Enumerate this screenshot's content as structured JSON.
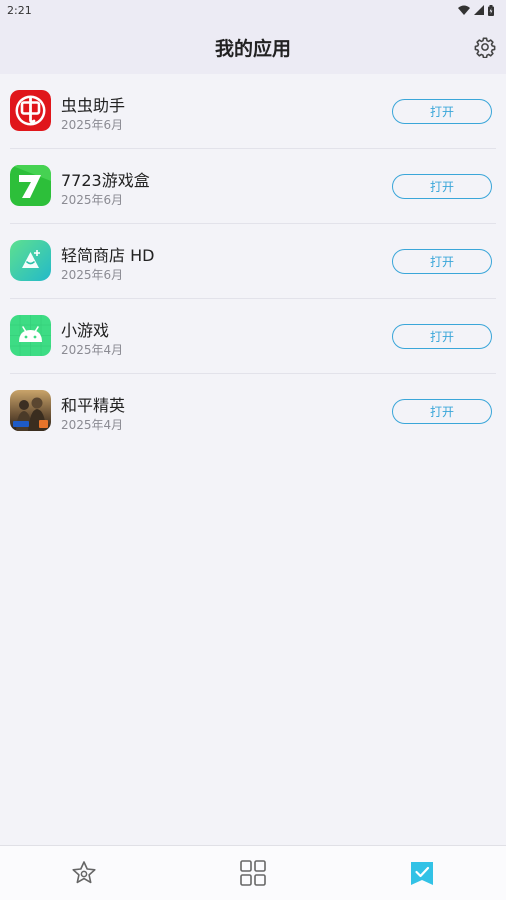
{
  "status_bar": {
    "time": "2:21"
  },
  "header": {
    "title": "我的应用"
  },
  "apps": [
    {
      "name": "虫虫助手",
      "date": "2025年6月",
      "action": "打开",
      "icon": "chongchong-logo"
    },
    {
      "name": "7723游戏盒",
      "date": "2025年6月",
      "action": "打开",
      "icon": "7723-logo"
    },
    {
      "name": "轻简商店 HD",
      "date": "2025年6月",
      "action": "打开",
      "icon": "store-logo"
    },
    {
      "name": "小游戏",
      "date": "2025年4月",
      "action": "打开",
      "icon": "android-logo"
    },
    {
      "name": "和平精英",
      "date": "2025年4月",
      "action": "打开",
      "icon": "game-art"
    }
  ],
  "bottom_nav": [
    {
      "name": "featured",
      "icon": "star-icon",
      "active": false
    },
    {
      "name": "categories",
      "icon": "grid-icon",
      "active": false
    },
    {
      "name": "my-apps",
      "icon": "checkmark-bookmark-icon",
      "active": true
    }
  ],
  "colors": {
    "accent": "#3aa6d9",
    "active_nav": "#32c2e6",
    "header_bg": "#ecebf4"
  }
}
